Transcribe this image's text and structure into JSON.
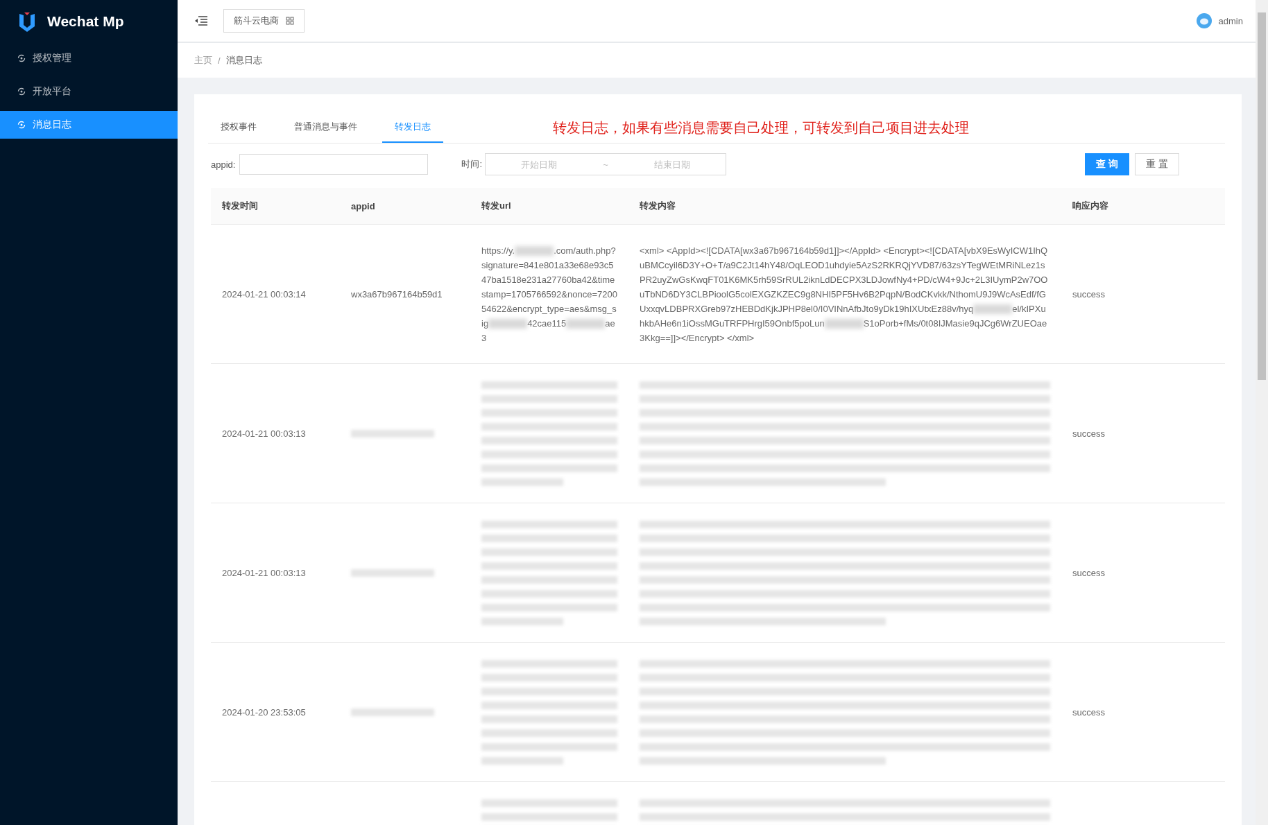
{
  "sidebar": {
    "logo": "Wechat Mp",
    "items": [
      {
        "label": "授权管理",
        "selected": false
      },
      {
        "label": "开放平台",
        "selected": false
      },
      {
        "label": "消息日志",
        "selected": true
      }
    ]
  },
  "header": {
    "project": "筋斗云电商",
    "user": "admin"
  },
  "breadcrumb": {
    "items": [
      "主页",
      "消息日志"
    ],
    "separator": "/"
  },
  "tabs": [
    {
      "label": "授权事件",
      "selected": false
    },
    {
      "label": "普通消息与事件",
      "selected": false
    },
    {
      "label": "转发日志",
      "selected": true
    }
  ],
  "note": "转发日志，如果有些消息需要自己处理，可转发到自己项目进去处理",
  "filters": {
    "appid_label": "appid:",
    "time_label": "时间:",
    "start_placeholder": "开始日期",
    "separator": "~",
    "end_placeholder": "结束日期",
    "search_button": "查 询",
    "reset_button": "重 置"
  },
  "table": {
    "columns": [
      "转发时间",
      "appid",
      "转发url",
      "转发内容",
      "响应内容"
    ],
    "rows": [
      {
        "kind": "clear",
        "time": "2024-01-21 00:03:14",
        "appid": "wx3a67b967164b59d1",
        "url": [
          {
            "kind": "text",
            "text": "https://y."
          },
          {
            "kind": "blur"
          },
          {
            "kind": "text",
            "text": ".com/auth.php?signature=841e801a33e68e93c547ba1518e231a27760ba42&timestamp=1705766592&nonce=720054622&encrypt_type=aes&msg_sig"
          },
          {
            "kind": "blur"
          },
          {
            "kind": "text",
            "text": "42cae115"
          },
          {
            "kind": "blur"
          },
          {
            "kind": "text",
            "text": "ae3"
          }
        ],
        "content": [
          {
            "kind": "text",
            "text": "<xml> <AppId><![CDATA[wx3a67b967164b59d1]]></AppId> <Encrypt><![CDATA[vbX9EsWyICW1IhQuBMCcyil6D3Y+O+T/a9C2Jt14hY48/OqLEOD1uhdyie5AzS2RKRQjYVD87/63zsYTegWEtMRiNLez1sPR2uyZwGsKwqFT01K6MK5rh59SrRUL2iknLdDECPX3LDJowfNy4+PD/cW4+9Jc+2L3IUymP2w7OOuTbND6DY3CLBPioolG5colEXGZKZEC9g8NHI5PF5Hv6B2PqpN/BodCKvkk/NthomU9J9WcAsEdf/fGUxxqvLDBPRXGreb97zHEBDdKjkJPHP8el0/I0VINnAfbJto9yDk19hIXUtxEz88v/hyq"
          },
          {
            "kind": "blur"
          },
          {
            "kind": "text",
            "text": "el/kIPXuhkbAHe6n1iOssMGuTRFPHrgI59Onbf5poLun"
          },
          {
            "kind": "blur"
          },
          {
            "kind": "text",
            "text": "S1oPorb+fMs/0t08IJMasie9qJCg6WrZUEOae3Kkg==]]></Encrypt> </xml>"
          }
        ],
        "response": "success"
      },
      {
        "kind": "blurred",
        "time": "2024-01-21 00:03:13",
        "response": "success"
      },
      {
        "kind": "blurred",
        "time": "2024-01-21 00:03:13",
        "response": "success"
      },
      {
        "kind": "blurred",
        "time": "2024-01-20 23:53:05",
        "response": "success"
      },
      {
        "kind": "cut"
      }
    ]
  }
}
